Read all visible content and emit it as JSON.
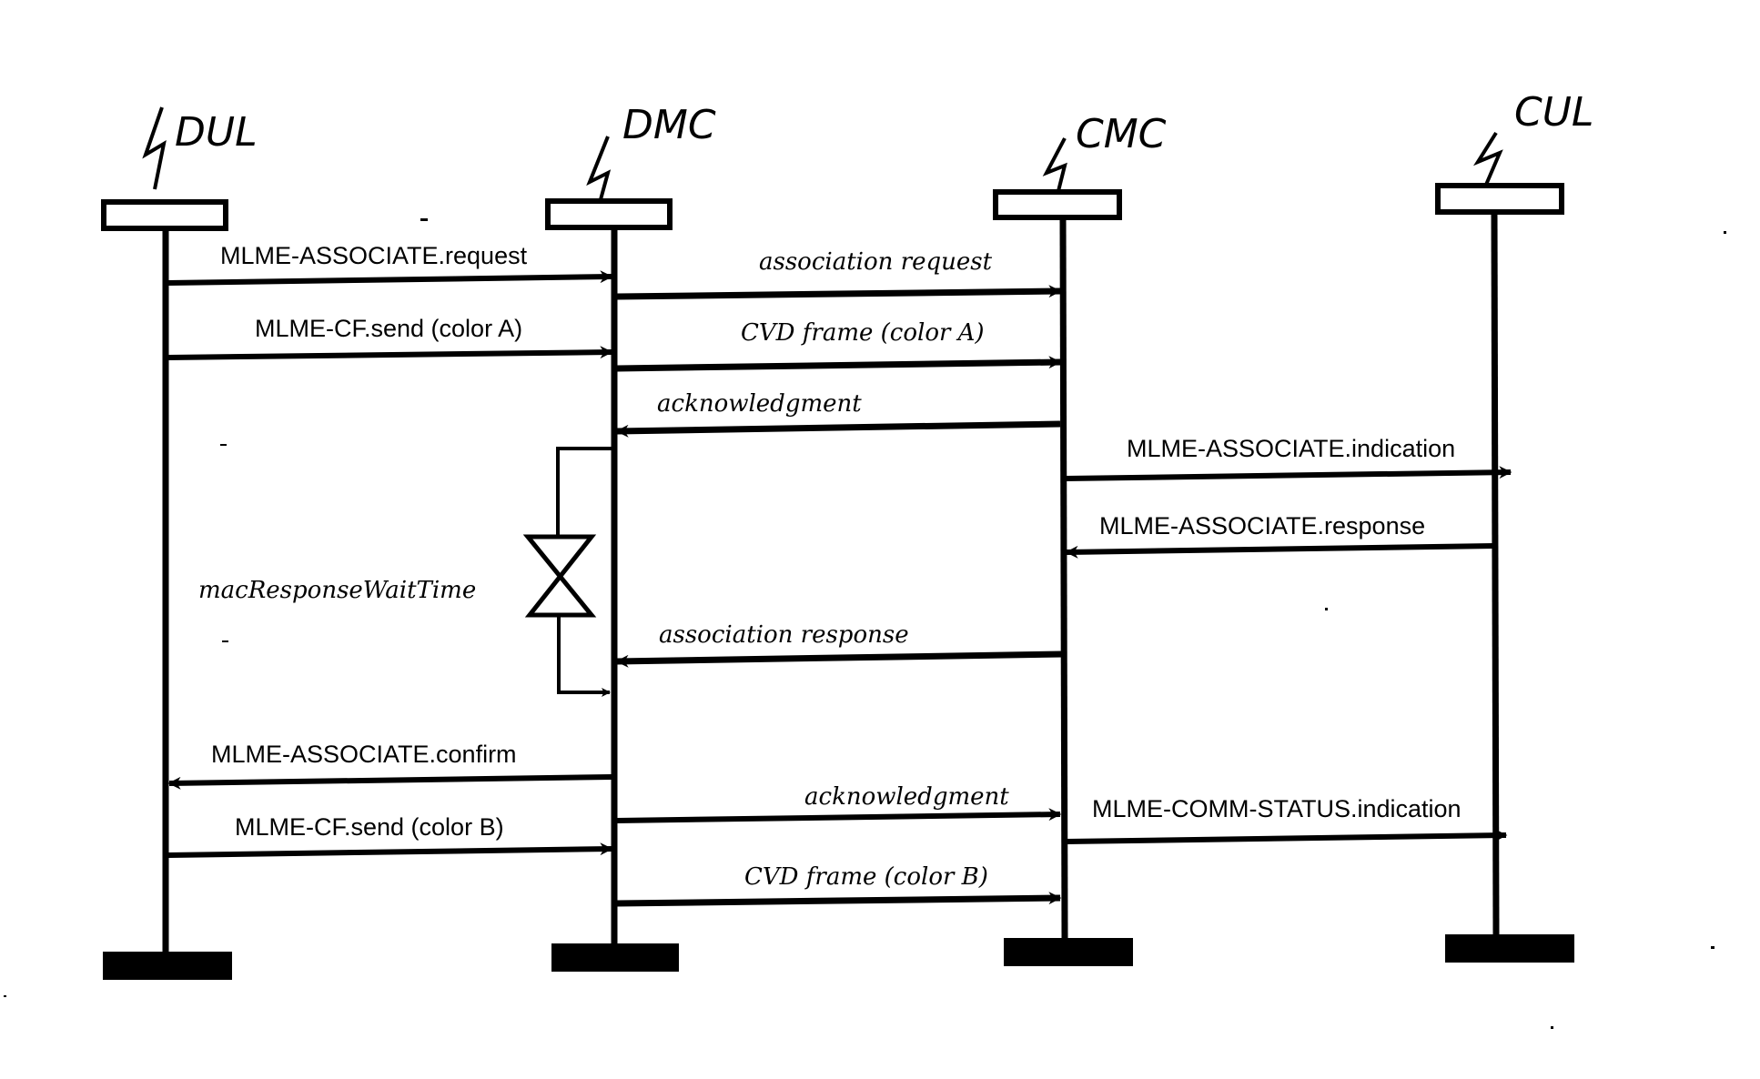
{
  "diagram": {
    "type": "sequence",
    "participants": [
      {
        "id": "DUL",
        "label": "DUL"
      },
      {
        "id": "DMC",
        "label": "DMC"
      },
      {
        "id": "CMC",
        "label": "CMC"
      },
      {
        "id": "CUL",
        "label": "CUL"
      }
    ],
    "messages": [
      {
        "from": "DUL",
        "to": "DMC",
        "label": "MLME-ASSOCIATE.request",
        "style": "primitive"
      },
      {
        "from": "DMC",
        "to": "CMC",
        "label": "association request",
        "style": "frame"
      },
      {
        "from": "DUL",
        "to": "DMC",
        "label": "MLME-CF.send (color A)",
        "style": "primitive"
      },
      {
        "from": "DMC",
        "to": "CMC",
        "label": "CVD frame (color A)",
        "style": "frame"
      },
      {
        "from": "CMC",
        "to": "DMC",
        "label": "acknowledgment",
        "style": "frame"
      },
      {
        "from": "CMC",
        "to": "CUL",
        "label": "MLME-ASSOCIATE.indication",
        "style": "primitive"
      },
      {
        "from": "CUL",
        "to": "CMC",
        "label": "MLME-ASSOCIATE.response",
        "style": "primitive"
      },
      {
        "from": "CMC",
        "to": "DMC",
        "label": "association response",
        "style": "frame"
      },
      {
        "from": "DMC",
        "to": "DUL",
        "label": "MLME-ASSOCIATE.confirm",
        "style": "primitive"
      },
      {
        "from": "DMC",
        "to": "CMC",
        "label": "acknowledgment",
        "style": "frame"
      },
      {
        "from": "CMC",
        "to": "CUL",
        "label": "MLME-COMM-STATUS.indication",
        "style": "primitive"
      },
      {
        "from": "DUL",
        "to": "DMC",
        "label": "MLME-CF.send (color B)",
        "style": "primitive"
      },
      {
        "from": "DMC",
        "to": "CMC",
        "label": "CVD frame (color B)",
        "style": "frame"
      }
    ],
    "timer": {
      "participant": "DMC",
      "label": "macResponseWaitTime"
    }
  }
}
